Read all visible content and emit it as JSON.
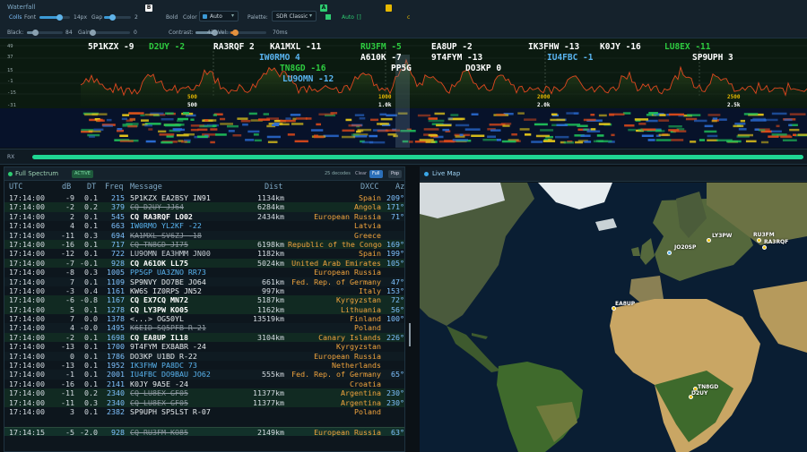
{
  "controls": {
    "title": "Waterfall",
    "colls_label": "Colls",
    "font_label": "Font",
    "font_value": "14px",
    "gap_label": "Gap",
    "gap_value": "2",
    "b_badge": "B",
    "bold_label": "Bold",
    "color_label": "Color",
    "color_value": "Auto",
    "palette_label": "Palette:",
    "palette_value": "SDR Classic",
    "a_badge": "A",
    "auto_label": "Auto",
    "auto_value": "[]",
    "black_label": "Black:",
    "black_value": "84",
    "gain_label": "Gain:",
    "gain_value": "0",
    "contrast_label": "Contrast:",
    "contrast_value": "42",
    "vel_label": "Vel:",
    "vel_value": "70ms",
    "accent": "#3c9ad6"
  },
  "spectrum": {
    "y_labels": [
      "49",
      "37",
      "15",
      "-1",
      "-15",
      "-31"
    ],
    "freq_labels_top": [
      "500",
      "1000",
      "2000",
      "2500"
    ],
    "freq_labels_bottom": [
      "500",
      "1.0k",
      "2.0k",
      "2.5k"
    ],
    "callsigns": [
      {
        "text": "5P1KZX -9",
        "color": "#ffffff"
      },
      {
        "text": "D2UY -2",
        "color": "#2ecc40"
      },
      {
        "text": "RA3RQF 2",
        "color": "#ffffff"
      },
      {
        "text": "KA1MXL -11",
        "color": "#ffffff"
      },
      {
        "text": "RU3FM -5",
        "color": "#2ecc40"
      },
      {
        "text": "EA8UP -2",
        "color": "#ffffff"
      },
      {
        "text": "IK3FHW -13",
        "color": "#ffffff"
      },
      {
        "text": "K0JY -16",
        "color": "#ffffff"
      },
      {
        "text": "LU8EX -11",
        "color": "#2ecc40"
      },
      {
        "text": "IW0RMO 4",
        "color": "#59b4f0"
      },
      {
        "text": "A610K -7",
        "color": "#ffffff"
      },
      {
        "text": "9T4FYM -13",
        "color": "#ffffff"
      },
      {
        "text": "IU4FBC -1",
        "color": "#59b4f0"
      },
      {
        "text": "SP9UPH 3",
        "color": "#ffffff"
      },
      {
        "text": "TN8GD -16",
        "color": "#2ecc40"
      },
      {
        "text": "PP5G",
        "color": "#ffffff"
      },
      {
        "text": "DO3KP 0",
        "color": "#ffffff"
      },
      {
        "text": "LU9OMN -12",
        "color": "#59b4f0"
      }
    ]
  },
  "rx": {
    "label": "RX",
    "progress": 1.0
  },
  "list": {
    "title": "Full Spectrum",
    "active_badge": "ACTIVE",
    "count_text": "25 decodes",
    "clear_label": "Clear",
    "full_label": "Full",
    "pop_label": "Pop",
    "columns": [
      "UTC",
      "dB",
      "DT",
      "Freq",
      "Message",
      "Dist",
      "DXCC",
      "Az"
    ],
    "rows": [
      {
        "utc": "17:14:00",
        "db": "-9",
        "dt": "0.1",
        "freq": "215",
        "msg": "5P1KZX EA2BSY IN91",
        "style": "m-white",
        "dist": "1134km",
        "dxcc": "Spain",
        "az": "209°",
        "bg": ""
      },
      {
        "utc": "17:14:00",
        "db": "-2",
        "dt": "0.2",
        "freq": "379",
        "msg": "CQ D2UY JJ64",
        "style": "m-strike",
        "dist": "6284km",
        "dxcc": "Angola",
        "az": "171°",
        "bg": "cq"
      },
      {
        "utc": "17:14:00",
        "db": "2",
        "dt": "0.1",
        "freq": "545",
        "msg": "CQ RA3RQF LO02",
        "style": "m-bold",
        "dist": "2434km",
        "dxcc": "European Russia",
        "az": "71°",
        "bg": "alt"
      },
      {
        "utc": "17:14:00",
        "db": "4",
        "dt": "0.1",
        "freq": "663",
        "msg": "IW0RMO YL2KF -22",
        "style": "m-blue",
        "dist": "",
        "dxcc": "Latvia",
        "az": "",
        "bg": ""
      },
      {
        "utc": "17:14:00",
        "db": "-11",
        "dt": "0.3",
        "freq": "694",
        "msg": "KA1MXL SV6ZJ -18",
        "style": "m-strike",
        "dist": "",
        "dxcc": "Greece",
        "az": "",
        "bg": "alt"
      },
      {
        "utc": "17:14:00",
        "db": "-16",
        "dt": "0.1",
        "freq": "717",
        "msg": "CQ TN8GD JI75",
        "style": "m-strike",
        "dist": "6198km",
        "dxcc": "Republic of the Congo",
        "az": "169°",
        "bg": "cq"
      },
      {
        "utc": "17:14:00",
        "db": "-12",
        "dt": "0.1",
        "freq": "722",
        "msg": "LU9OMN EA3HMM JN00",
        "style": "m-dim",
        "dist": "1182km",
        "dxcc": "Spain",
        "az": "199°",
        "bg": ""
      },
      {
        "utc": "17:14:00",
        "db": "-7",
        "dt": "-0.1",
        "freq": "928",
        "msg": "CQ A61OK LL75",
        "style": "m-bold",
        "dist": "5024km",
        "dxcc": "United Arab Emirates",
        "az": "105°",
        "bg": "cq"
      },
      {
        "utc": "17:14:00",
        "db": "-8",
        "dt": "0.3",
        "freq": "1005",
        "msg": "PP5GP UA3ZNO RR73",
        "style": "m-blue",
        "dist": "",
        "dxcc": "European Russia",
        "az": "",
        "bg": ""
      },
      {
        "utc": "17:14:00",
        "db": "7",
        "dt": "0.1",
        "freq": "1109",
        "msg": "SP9NVY DO7BE JO64",
        "style": "m-white",
        "dist": "661km",
        "dxcc": "Fed. Rep. of Germany",
        "az": "47°",
        "bg": "alt"
      },
      {
        "utc": "17:14:00",
        "db": "-3",
        "dt": "0.4",
        "freq": "1161",
        "msg": "KW6S IZ0RPS JN52",
        "style": "m-white",
        "dist": "997km",
        "dxcc": "Italy",
        "az": "153°",
        "bg": ""
      },
      {
        "utc": "17:14:00",
        "db": "-6",
        "dt": "-0.8",
        "freq": "1167",
        "msg": "CQ EX7CQ MN72",
        "style": "m-bold",
        "dist": "5187km",
        "dxcc": "Kyrgyzstan",
        "az": "72°",
        "bg": "cq"
      },
      {
        "utc": "17:14:00",
        "db": "5",
        "dt": "0.1",
        "freq": "1278",
        "msg": "CQ LY3PW KO05",
        "style": "m-bold",
        "dist": "1162km",
        "dxcc": "Lithuania",
        "az": "56°",
        "bg": "cq"
      },
      {
        "utc": "17:14:00",
        "db": "7",
        "dt": "0.0",
        "freq": "1378",
        "msg": "<...> OG50YL",
        "style": "m-white",
        "dist": "13519km",
        "dxcc": "Finland",
        "az": "100°",
        "bg": ""
      },
      {
        "utc": "17:14:00",
        "db": "4",
        "dt": "-0.0",
        "freq": "1495",
        "msg": "K6EID SQ5PFB R-21",
        "style": "m-strike",
        "dist": "",
        "dxcc": "Poland",
        "az": "",
        "bg": "alt"
      },
      {
        "utc": "17:14:00",
        "db": "-2",
        "dt": "0.1",
        "freq": "1698",
        "msg": "CQ EA8UP IL18",
        "style": "m-bold",
        "dist": "3104km",
        "dxcc": "Canary Islands",
        "az": "226°",
        "bg": "cq"
      },
      {
        "utc": "17:14:00",
        "db": "-13",
        "dt": "0.1",
        "freq": "1700",
        "msg": "9T4FYM EX8ABR -24",
        "style": "m-white",
        "dist": "",
        "dxcc": "Kyrgyzstan",
        "az": "",
        "bg": ""
      },
      {
        "utc": "17:14:00",
        "db": "0",
        "dt": "0.1",
        "freq": "1786",
        "msg": "DO3KP U1BD R-22",
        "style": "m-white",
        "dist": "",
        "dxcc": "European Russia",
        "az": "",
        "bg": "alt"
      },
      {
        "utc": "17:14:00",
        "db": "-13",
        "dt": "0.1",
        "freq": "1952",
        "msg": "IK3FHW PA8DC 73",
        "style": "m-blue",
        "dist": "",
        "dxcc": "Netherlands",
        "az": "",
        "bg": ""
      },
      {
        "utc": "17:14:00",
        "db": "-1",
        "dt": "0.1",
        "freq": "2001",
        "msg": "IU4FBC DO9BAU JO62",
        "style": "m-blue",
        "dist": "555km",
        "dxcc": "Fed. Rep. of Germany",
        "az": "65°",
        "bg": "alt"
      },
      {
        "utc": "17:14:00",
        "db": "-16",
        "dt": "0.1",
        "freq": "2141",
        "msg": "K0JY 9A5E -24",
        "style": "m-white",
        "dist": "",
        "dxcc": "Croatia",
        "az": "",
        "bg": ""
      },
      {
        "utc": "17:14:00",
        "db": "-11",
        "dt": "0.2",
        "freq": "2340",
        "msg": "CQ LU8EX GF05",
        "style": "m-strike",
        "dist": "11377km",
        "dxcc": "Argentina",
        "az": "230°",
        "bg": "cq"
      },
      {
        "utc": "17:14:00",
        "db": "-11",
        "dt": "0.3",
        "freq": "2340",
        "msg": "CQ LU8EX GF05",
        "style": "m-strike",
        "dist": "11377km",
        "dxcc": "Argentina",
        "az": "230°",
        "bg": "cq"
      },
      {
        "utc": "17:14:00",
        "db": "3",
        "dt": "0.1",
        "freq": "2382",
        "msg": "SP9UPH SP5LST R-07",
        "style": "m-white",
        "dist": "",
        "dxcc": "Poland",
        "az": "",
        "bg": ""
      }
    ],
    "last": {
      "utc": "17:14:15",
      "db": "-5",
      "dt": "-2.0",
      "freq": "928",
      "msg": "CQ RU3FM KO85",
      "style": "m-strike",
      "dist": "2149km",
      "dxcc": "European Russia",
      "az": "63°"
    }
  },
  "map": {
    "title": "Live Map",
    "stations": [
      {
        "label": "JO20SP",
        "color": "#59b4f0"
      },
      {
        "label": "LY3PW",
        "color": "#f1c40f"
      },
      {
        "label": "RU3FM",
        "color": "#f1c40f"
      },
      {
        "label": "RA3RQF",
        "color": "#f1c40f"
      },
      {
        "label": "EA8UP",
        "color": "#f1c40f"
      },
      {
        "label": "TN8GD",
        "color": "#f1c40f"
      },
      {
        "label": "D2UY",
        "color": "#f1c40f"
      }
    ]
  }
}
